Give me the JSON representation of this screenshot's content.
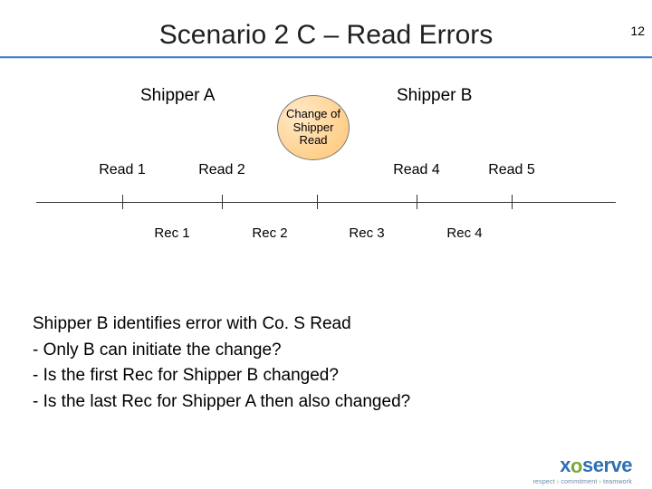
{
  "page_number": "12",
  "title": "Scenario 2 C – Read Errors",
  "diagram": {
    "shipper_a": "Shipper A",
    "shipper_b": "Shipper B",
    "change_bubble": "Change of Shipper Read",
    "reads": {
      "r1": "Read 1",
      "r2": "Read 2",
      "r4": "Read 4",
      "r5": "Read 5"
    },
    "recs": {
      "rec1": "Rec 1",
      "rec2": "Rec 2",
      "rec3": "Rec 3",
      "rec4": "Rec 4"
    }
  },
  "body": {
    "line1": "Shipper B identifies error with Co. S Read",
    "b1": "-  Only B can initiate the change?",
    "b2": "-  Is the first Rec for Shipper B changed?",
    "b3": "-  Is the last Rec for Shipper A then also changed?"
  },
  "logo": {
    "name": "xoserve",
    "tag_respect": "respect",
    "tag_commitment": "commitment",
    "tag_teamwork": "teamwork"
  }
}
